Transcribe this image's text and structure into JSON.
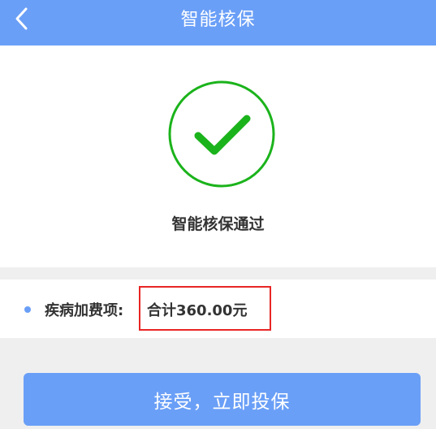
{
  "header": {
    "title": "智能核保",
    "back_icon": "chevron-left-icon"
  },
  "result": {
    "icon": "check-circle-icon",
    "message": "智能核保通过"
  },
  "fee": {
    "label": "疾病加费项:",
    "total": "合计360.00元"
  },
  "actions": {
    "accept_label": "接受，立即投保"
  },
  "colors": {
    "primary": "#6a9ff7",
    "success": "#1bb31b",
    "highlight_border": "#e82525",
    "background": "#efefef"
  }
}
